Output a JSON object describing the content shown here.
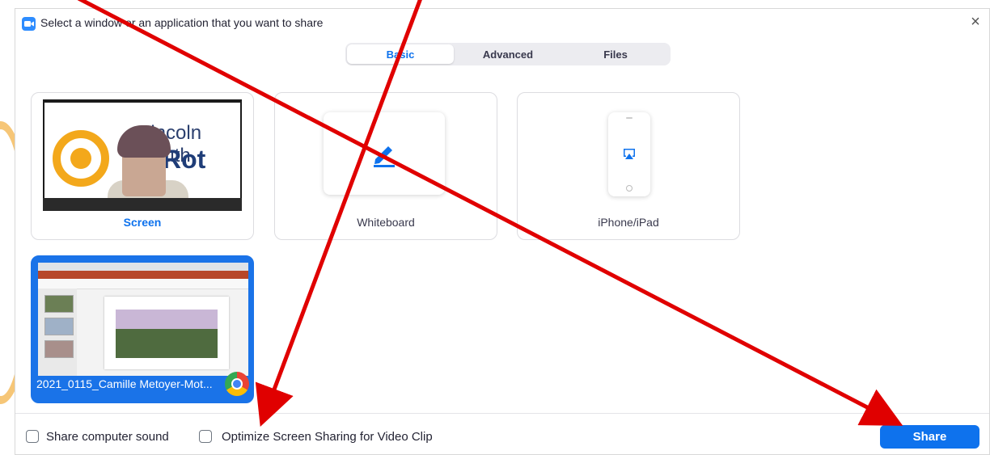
{
  "window": {
    "title": "Select a window or an application that you want to share",
    "close_glyph": "×"
  },
  "tabs": [
    {
      "label": "Basic",
      "active": true
    },
    {
      "label": "Advanced",
      "active": false
    },
    {
      "label": "Files",
      "active": false
    }
  ],
  "cards": {
    "screen": {
      "label": "Screen",
      "preview_text_1": "Lincoln South",
      "preview_text_2": "Rot"
    },
    "whiteboard": {
      "label": "Whiteboard",
      "icon": "pen-icon"
    },
    "iphone": {
      "label": "iPhone/iPad",
      "icon": "airplay-icon"
    },
    "chrome_window": {
      "label": "2021_0115_Camille Metoyer-Mot...",
      "icon": "chrome-icon",
      "selected": true
    }
  },
  "footer": {
    "share_sound_label": "Share computer sound",
    "share_sound_checked": false,
    "optimize_label": "Optimize Screen Sharing for Video Clip",
    "optimize_checked": false,
    "share_button": "Share"
  },
  "colors": {
    "accent": "#0e72ed",
    "selected_card": "#1a73e8",
    "annotation_arrow": "#e00000"
  }
}
